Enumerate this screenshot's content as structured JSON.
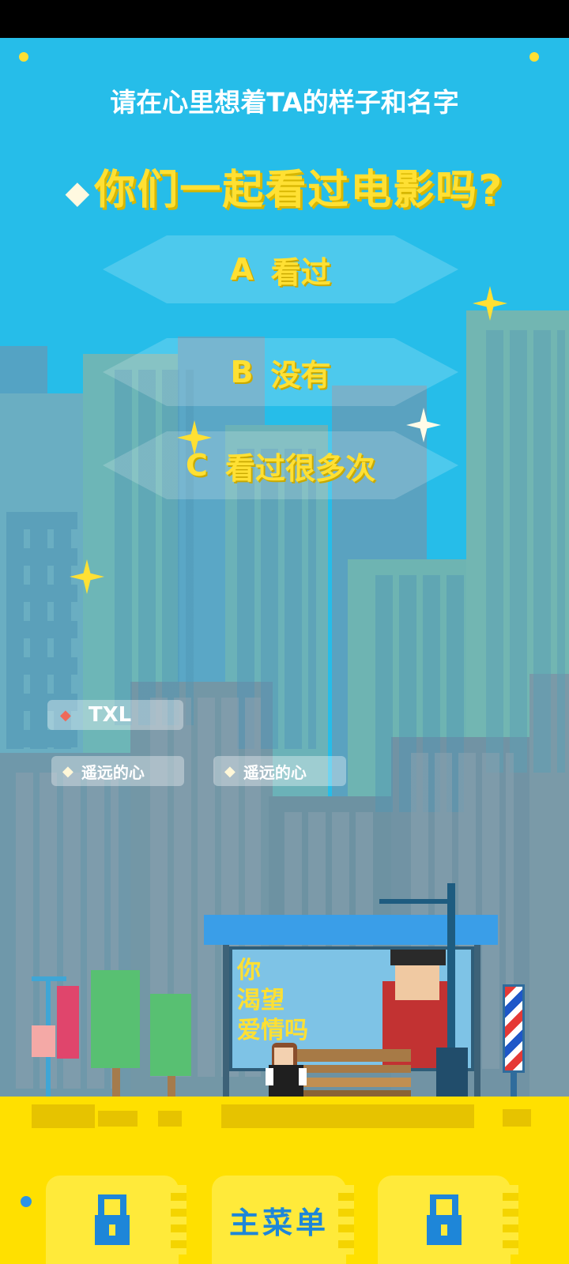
{
  "prompt": "请在心里想着TA的样子和名字",
  "question": {
    "diamond": "◆",
    "text": "你们一起看过电影吗?"
  },
  "options": [
    {
      "letter": "A",
      "text": "看过"
    },
    {
      "letter": "B",
      "text": "没有"
    },
    {
      "letter": "C",
      "text": "看过很多次"
    }
  ],
  "tags": {
    "name_tag": {
      "diamond": "◆",
      "text": "TXL"
    },
    "heart_tags": [
      {
        "diamond": "◆",
        "text": "遥远的心"
      },
      {
        "diamond": "◆",
        "text": "遥远的心"
      }
    ]
  },
  "billboard": {
    "lines": [
      "你",
      "渴望",
      "爱情吗"
    ]
  },
  "bottom_bar": {
    "left_icon": "lock-icon",
    "menu_label": "主菜单",
    "right_icon": "lock-icon"
  },
  "colors": {
    "sky": "#26bde9",
    "title_yellow": "#ffe033",
    "ground": "#ffe000",
    "menu_text": "#1e86d8"
  }
}
